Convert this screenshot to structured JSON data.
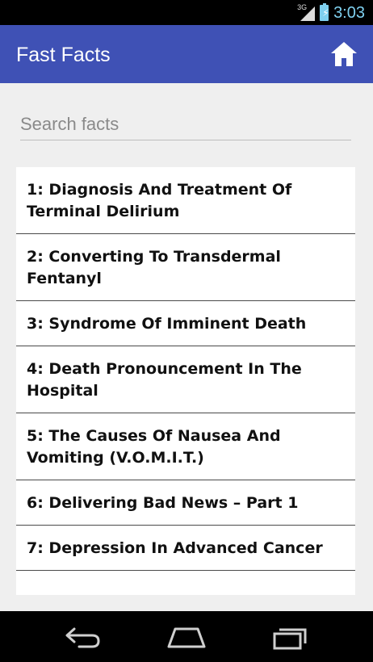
{
  "status_bar": {
    "network": "3G",
    "time": "3:03"
  },
  "action_bar": {
    "title": "Fast Facts",
    "home_icon": "home-icon"
  },
  "search": {
    "placeholder": "Search facts",
    "value": ""
  },
  "facts": [
    "1: Diagnosis And Treatment Of Terminal Delirium",
    "2: Converting To Transdermal Fentanyl",
    "3: Syndrome Of Imminent Death",
    "4: Death Pronouncement In The Hospital",
    "5: The Causes Of Nausea And Vomiting (V.O.M.I.T.)",
    "6: Delivering Bad News – Part 1",
    "7: Depression In Advanced Cancer"
  ],
  "nav_bar": {
    "icons": [
      "back-icon",
      "home-nav-icon",
      "recent-apps-icon"
    ]
  },
  "colors": {
    "primary": "#3f51b5",
    "status_accent": "#7fd0ef",
    "background": "#efefef"
  }
}
